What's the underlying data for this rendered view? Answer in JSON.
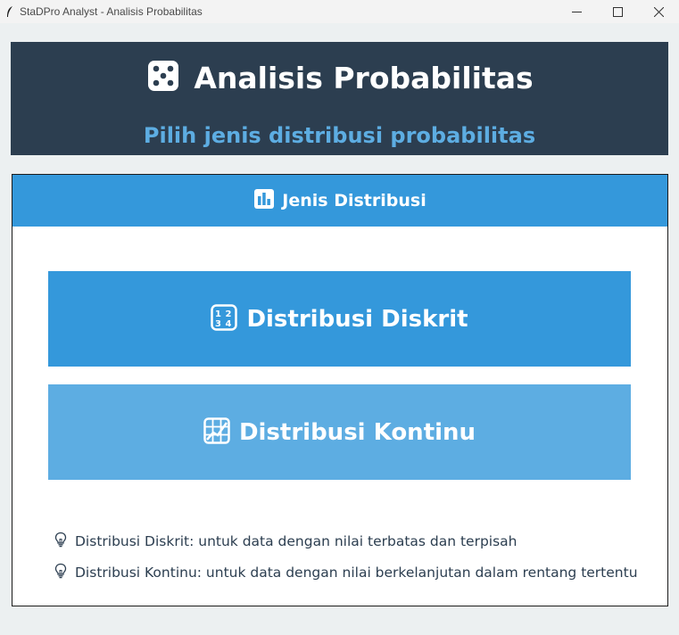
{
  "window": {
    "title": "StaDPro Analyst - Analisis Probabilitas",
    "icon": "feather-icon"
  },
  "header": {
    "icon": "dice-icon",
    "title": "Analisis Probabilitas",
    "subtitle": "Pilih jenis distribusi probabilitas"
  },
  "panel": {
    "icon": "bar-chart-icon",
    "title": "Jenis Distribusi",
    "buttons": [
      {
        "icon": "numbers-icon",
        "label": "Distribusi Diskrit"
      },
      {
        "icon": "grid-chart-icon",
        "label": "Distribusi Kontinu"
      }
    ],
    "info": [
      {
        "icon": "lightbulb-icon",
        "text": "Distribusi Diskrit: untuk data dengan nilai terbatas dan terpisah"
      },
      {
        "icon": "lightbulb-icon",
        "text": "Distribusi Kontinu: untuk data dengan nilai berkelanjutan dalam rentang tertentu"
      }
    ]
  },
  "colors": {
    "header_bg": "#2c3e50",
    "subtitle": "#5dade2",
    "primary": "#3498db",
    "secondary": "#5dade2",
    "window_bg": "#ecf0f1"
  }
}
